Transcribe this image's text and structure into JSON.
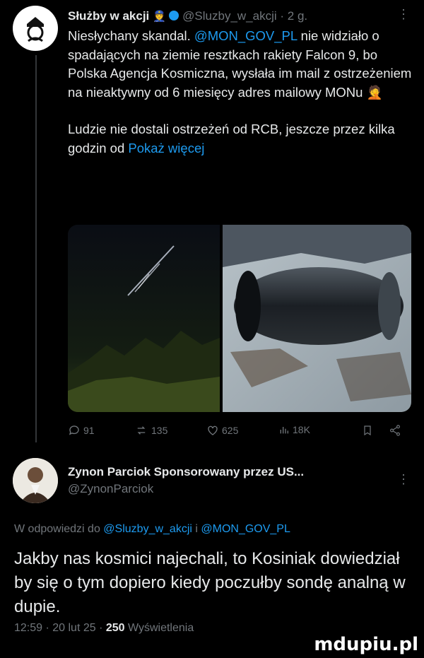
{
  "post": {
    "display_name": "Służby w akcji",
    "handle": "@Sluzby_w_akcji",
    "time": "2 g.",
    "body_parts": {
      "p1_a": "Niesłychany skandal. ",
      "mention": "@MON_GOV_PL",
      "p1_b": " nie widziało o spadających na ziemie resztkach rakiety Falcon 9, bo Polska Agencja Kosmiczna, wysłała im mail z ostrzeżeniem na nieaktywny od 6 miesięcy adres mailowy MONu ",
      "p2": "Ludzie nie dostali ostrzeżeń od RCB, jeszcze przez kilka godzin od ",
      "show_more": "Pokaż więcej"
    },
    "stats": {
      "replies": "91",
      "reposts": "135",
      "likes": "625",
      "views": "18K"
    }
  },
  "reply": {
    "display_name": "Zynon Parciok",
    "sponsored": "Sponsorowany przez US...",
    "handle": "@ZynonParciok",
    "reply_prefix": "W odpowiedzi do ",
    "reply_to_1": "@Sluzby_w_akcji",
    "reply_and": " i ",
    "reply_to_2": "@MON_GOV_PL",
    "body": "Jakby nas kosmici najechali, to Kosiniak dowiedział by się o tym dopiero kiedy poczułby sondę analną w dupie.",
    "time": "12:59 · 20 lut 25 · ",
    "views_count": "250",
    "views_label": " Wyświetlenia"
  },
  "watermark": "mdupiu.pl",
  "colors": {
    "background": "#000000",
    "text": "#e7e9ea",
    "muted": "#71767b",
    "link": "#1d9bf0"
  }
}
